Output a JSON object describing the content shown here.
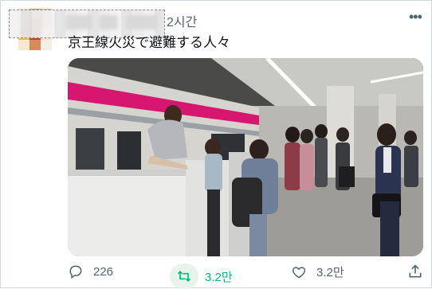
{
  "post": {
    "timestamp": "2시간",
    "caption": "京王線火災で避難する人々",
    "more_icon": "more-horizontal-icon"
  },
  "actions": {
    "reply": {
      "icon": "reply-icon",
      "count": "226"
    },
    "retweet": {
      "icon": "retweet-icon",
      "count": "3.2만",
      "color": "#00ba7c"
    },
    "like": {
      "icon": "heart-icon",
      "count": "3.2만"
    },
    "share": {
      "icon": "share-icon"
    }
  },
  "colors": {
    "text": "#0f1419",
    "muted": "#536471",
    "border": "#cfd9de",
    "train_stripe": "#d6166f"
  }
}
